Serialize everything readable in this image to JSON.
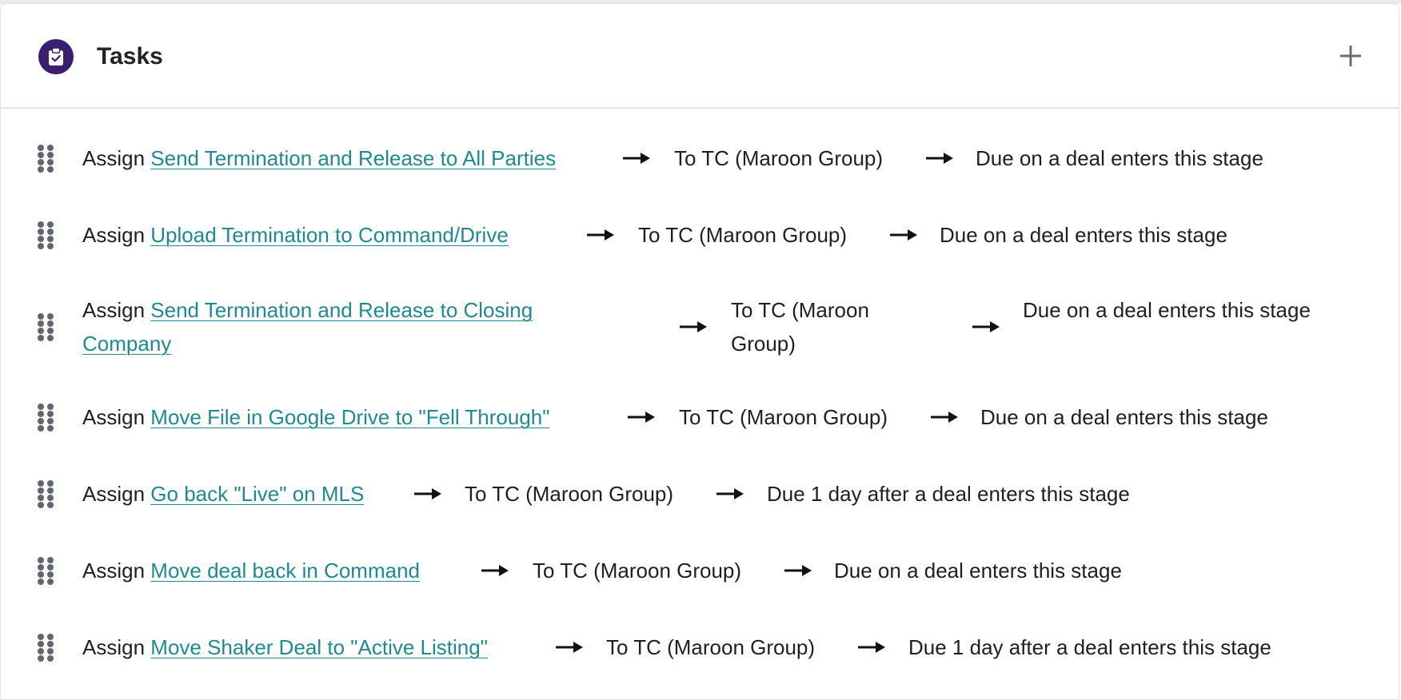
{
  "header": {
    "title": "Tasks",
    "icon": "clipboard-check-icon",
    "add_icon": "plus-icon",
    "accent": "#3b1e6e"
  },
  "link_color": "#1d8a92",
  "tasks": [
    {
      "assign_label": "Assign",
      "task_name": "Send Termination and Release to All Parties",
      "assignee": "To TC (Maroon Group)",
      "due": "Due on a deal enters this stage"
    },
    {
      "assign_label": "Assign",
      "task_name": "Upload Termination to Command/Drive",
      "assignee": "To TC (Maroon Group)",
      "due": "Due on a deal enters this stage"
    },
    {
      "assign_label": "Assign",
      "task_name": "Send Termination and Release to Closing Company",
      "assignee": "To TC (Maroon Group)",
      "due": "Due on a deal enters this stage"
    },
    {
      "assign_label": "Assign",
      "task_name": "Move File in Google Drive to \"Fell Through\"",
      "assignee": "To TC (Maroon Group)",
      "due": "Due on a deal enters this stage"
    },
    {
      "assign_label": "Assign",
      "task_name": "Go back \"Live\" on MLS",
      "assignee": "To TC (Maroon Group)",
      "due": "Due 1 day after a deal enters this stage"
    },
    {
      "assign_label": "Assign",
      "task_name": "Move deal back in Command",
      "assignee": "To TC (Maroon Group)",
      "due": "Due on a deal enters this stage"
    },
    {
      "assign_label": "Assign",
      "task_name": "Move Shaker Deal to \"Active Listing\"",
      "assignee": "To TC (Maroon Group)",
      "due": "Due 1 day after a deal enters this stage"
    }
  ]
}
